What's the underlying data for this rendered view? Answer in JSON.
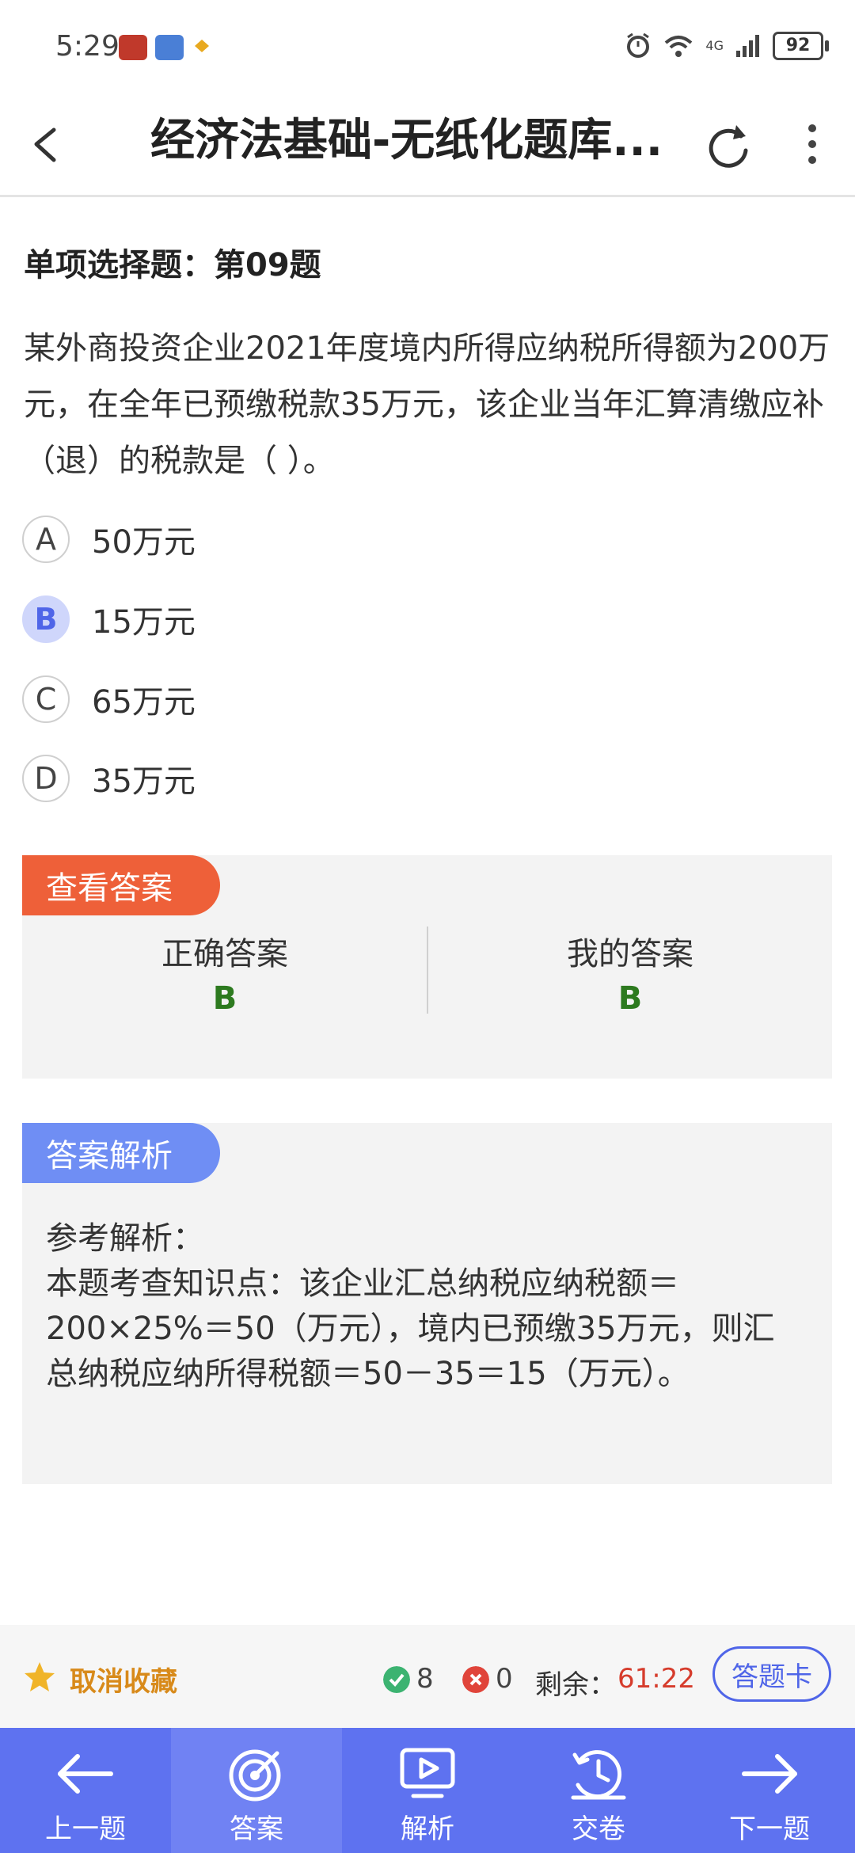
{
  "status": {
    "time": "5:29",
    "network": "4G",
    "battery": "92"
  },
  "header": {
    "title": "经济法基础-无纸化题库..."
  },
  "question": {
    "type_label": "单项选择题：第09题",
    "text": "某外商投资企业2021年度境内所得应纳税所得额为200万元，在全年已预缴税款35万元，该企业当年汇算清缴应补（退）的税款是（  ）。",
    "options": [
      {
        "letter": "A",
        "text": "50万元",
        "selected": false
      },
      {
        "letter": "B",
        "text": "15万元",
        "selected": true
      },
      {
        "letter": "C",
        "text": "65万元",
        "selected": false
      },
      {
        "letter": "D",
        "text": "35万元",
        "selected": false
      }
    ]
  },
  "answer_panel": {
    "tag": "查看答案",
    "correct_label": "正确答案",
    "correct_value": "B",
    "mine_label": "我的答案",
    "mine_value": "B"
  },
  "analysis_panel": {
    "tag": "答案解析",
    "text": "参考解析：\n本题考查知识点：该企业汇总纳税应纳税额＝200×25%＝50（万元），境内已预缴35万元，则汇总纳税应纳所得税额＝50－35＝15（万元）。"
  },
  "toolbar": {
    "favorite_label": "取消收藏",
    "correct_count": "8",
    "wrong_count": "0",
    "remaining_label": "剩余：",
    "remaining_time": "61:22",
    "card_button": "答题卡"
  },
  "nav": [
    {
      "label": "上一题",
      "icon": "arrow-left-icon"
    },
    {
      "label": "答案",
      "icon": "target-icon"
    },
    {
      "label": "解析",
      "icon": "play-screen-icon"
    },
    {
      "label": "交卷",
      "icon": "submit-clock-icon"
    },
    {
      "label": "下一题",
      "icon": "arrow-right-icon"
    }
  ],
  "colors": {
    "accent": "#5e72f0",
    "answer_tag": "#ee6039",
    "analysis_tag": "#6f8ef4",
    "correct_green": "#2d7a1f",
    "timer_red": "#d63c2c"
  }
}
